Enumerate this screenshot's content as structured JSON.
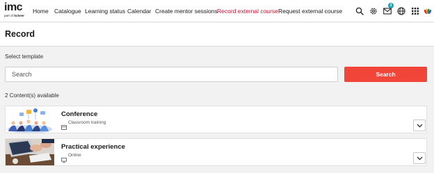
{
  "logo": {
    "main": "imc",
    "sub_prefix": "part of",
    "sub_brand": "Scheer"
  },
  "nav": {
    "items": [
      {
        "label": "Home"
      },
      {
        "label": "Catalogue"
      },
      {
        "label": "Learning status"
      },
      {
        "label": "Calendar"
      },
      {
        "label": "Create mentor sessions"
      },
      {
        "label": "Record external course",
        "active": true
      },
      {
        "label": "Request external course"
      }
    ],
    "icons": [
      "search-icon",
      "settings-icon",
      "mail-icon",
      "globe-icon",
      "apps-grid-icon",
      "brand-peacock-icon"
    ],
    "mail_badge": "3",
    "active_color": "#c8102e"
  },
  "page": {
    "title": "Record"
  },
  "template": {
    "label": "Select template",
    "search_placeholder": "Search",
    "search_button": "Search",
    "accent": "#f2453a"
  },
  "results": {
    "count_text": "2 Content(s) available",
    "items": [
      {
        "title": "Conference",
        "type": "Classroom training",
        "type_icon": "classroom-icon"
      },
      {
        "title": "Practical experience",
        "type": "Online",
        "type_icon": "online-icon"
      }
    ]
  }
}
